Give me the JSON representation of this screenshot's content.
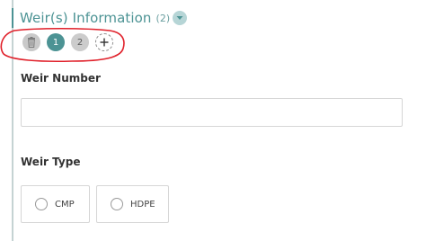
{
  "section": {
    "title": "Weir(s) Information",
    "count": "(2)",
    "toggle_icon": "chevron-down-icon"
  },
  "toolbar": {
    "delete_icon": "trash-icon",
    "items": [
      {
        "label": "1",
        "state": "active"
      },
      {
        "label": "2",
        "state": "inactive"
      }
    ],
    "add_icon": "plus-icon"
  },
  "fields": {
    "weir_number": {
      "label": "Weir Number",
      "value": "",
      "placeholder": ""
    },
    "weir_type": {
      "label": "Weir Type",
      "options": [
        {
          "label": "CMP",
          "selected": false
        },
        {
          "label": "HDPE",
          "selected": false
        }
      ]
    }
  },
  "colors": {
    "accent": "#4c9394",
    "accent_light": "#b6d5d6",
    "annotation": "#e0202a",
    "border": "#d6d6d6"
  }
}
